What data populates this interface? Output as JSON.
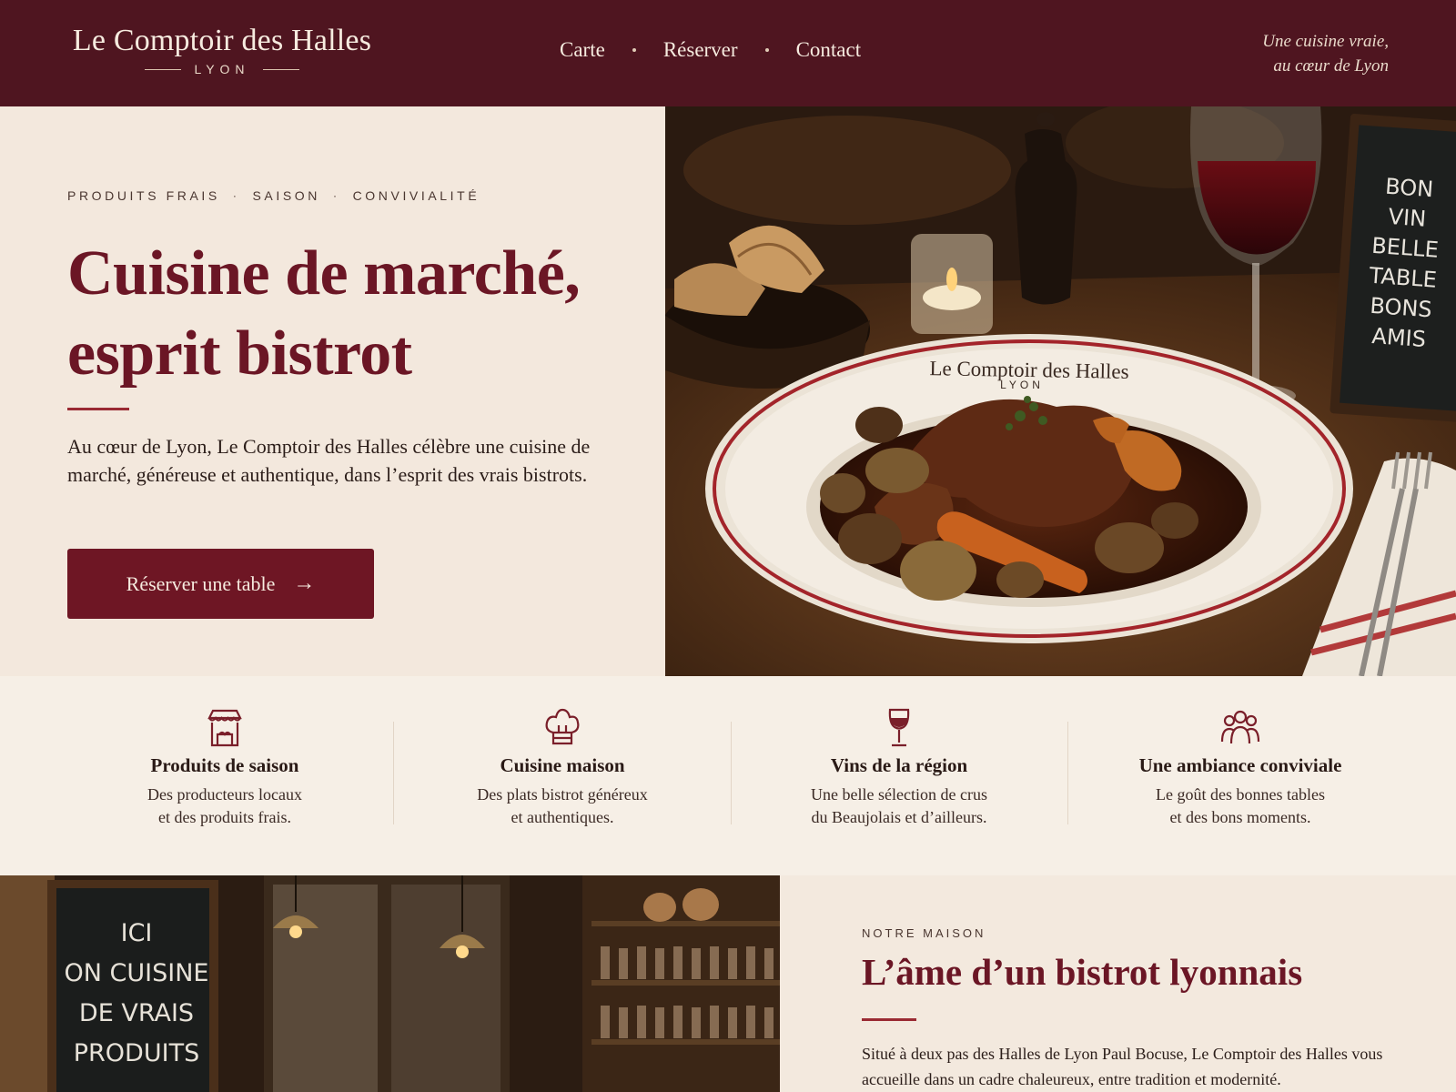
{
  "header": {
    "brand_name": "Le Comptoir des Halles",
    "brand_city": "LYON",
    "nav": [
      {
        "label": "Carte"
      },
      {
        "label": "Réserver"
      },
      {
        "label": "Contact"
      }
    ],
    "tagline_line1": "Une cuisine vraie,",
    "tagline_line2": "au cœur de Lyon"
  },
  "hero": {
    "eyebrow": [
      "PRODUITS FRAIS",
      "SAISON",
      "CONVIVIALITÉ"
    ],
    "title_line1": "Cuisine de marché,",
    "title_line2": "esprit bistrot",
    "text": "Au cœur de Lyon, Le Comptoir des Halles célèbre une cuisine de marché, généreuse et authentique, dans l’esprit des vrais bistrots.",
    "cta_label": "Réserver une table",
    "cta_arrow": "→",
    "image": {
      "plate_brand": "Le Comptoir des Halles",
      "plate_city": "LYON",
      "chalkboard": [
        "BON",
        "VIN",
        "BELLE",
        "TABLE",
        "BONS",
        "AMIS"
      ]
    }
  },
  "features": [
    {
      "icon": "market-stall-icon",
      "title": "Produits de saison",
      "line1": "Des producteurs locaux",
      "line2": "et des produits frais."
    },
    {
      "icon": "chef-hat-icon",
      "title": "Cuisine maison",
      "line1": "Des plats bistrot généreux",
      "line2": "et authentiques."
    },
    {
      "icon": "wine-glass-icon",
      "title": "Vins de la région",
      "line1": "Une belle sélection de crus",
      "line2": "du Beaujolais et d’ailleurs."
    },
    {
      "icon": "people-icon",
      "title": "Une ambiance conviviale",
      "line1": "Le goût des bonnes tables",
      "line2": "et des bons moments."
    }
  ],
  "about": {
    "image_sign": [
      "ICI",
      "ON CUISINE",
      "DE VRAIS",
      "PRODUITS"
    ],
    "eyebrow": "NOTRE MAISON",
    "title": "L’âme d’un bistrot lyonnais",
    "text": "Situé à deux pas des Halles de Lyon Paul Bocuse, Le Comptoir des Halles vous accueille dans un cadre chaleureux, entre tradition et modernité."
  },
  "colors": {
    "header_bg": "#4f1520",
    "accent": "#6b1625",
    "cream": "#f3e8dd"
  }
}
